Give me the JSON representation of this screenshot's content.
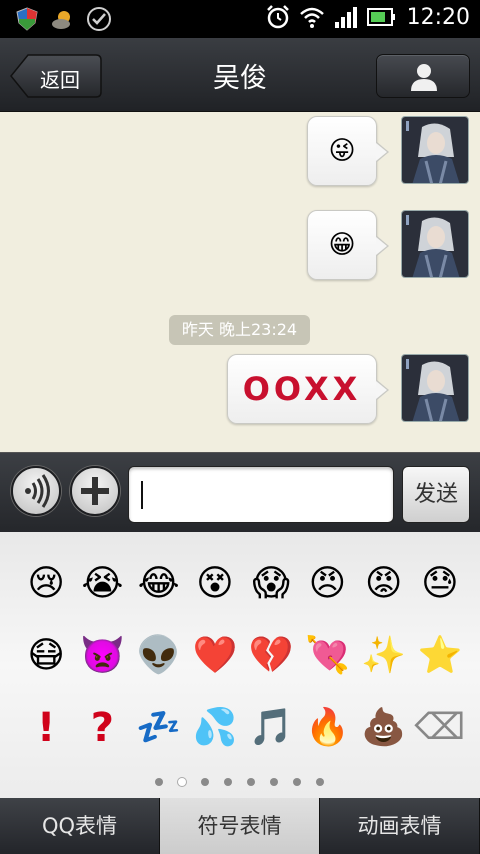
{
  "status_bar": {
    "time": "12:20",
    "left_icons": [
      "shield-icon",
      "weather-icon",
      "check-circle-icon"
    ],
    "right_icons": [
      "alarm-icon",
      "wifi-icon",
      "signal-icon",
      "battery-icon"
    ]
  },
  "header": {
    "back_label": "返回",
    "title": "吴俊"
  },
  "chat": {
    "messages": [
      {
        "type": "emoji",
        "content": "😜"
      },
      {
        "type": "emoji",
        "content": "😁"
      },
      {
        "type": "text",
        "content": "OOXX"
      }
    ],
    "timestamp": "昨天 晚上23:24"
  },
  "input_bar": {
    "value": "",
    "send_label": "发送"
  },
  "emoji_panel": {
    "rows": [
      [
        "😢",
        "😭",
        "😂",
        "😵",
        "😱",
        "😠",
        "😡",
        "😓"
      ],
      [
        "😷",
        "👿",
        "👽",
        "❤️",
        "💔",
        "💘",
        "✨",
        "⭐"
      ],
      [
        "!",
        "?",
        "💤",
        "💦",
        "🎵",
        "🔥",
        "💩",
        "⌫"
      ]
    ],
    "page_count": 8,
    "current_page": 2
  },
  "tabs": [
    {
      "label": "QQ表情",
      "active": false
    },
    {
      "label": "符号表情",
      "active": true
    },
    {
      "label": "动画表情",
      "active": false
    }
  ],
  "colors": {
    "chat_bg": "#f1eedf",
    "accent_red": "#c8102e"
  }
}
